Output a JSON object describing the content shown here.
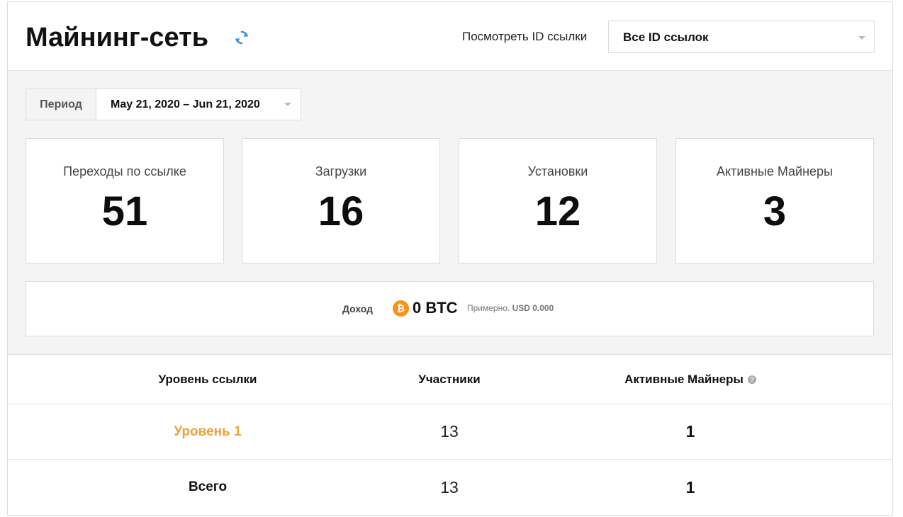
{
  "header": {
    "title": "Майнинг-сеть",
    "id_filter_label": "Посмотреть ID ссылки",
    "id_filter_value": "Все ID ссылок"
  },
  "period": {
    "label": "Период",
    "value": "May 21, 2020 – Jun 21, 2020"
  },
  "stats": [
    {
      "label": "Переходы по ссылке",
      "value": "51"
    },
    {
      "label": "Загрузки",
      "value": "16"
    },
    {
      "label": "Установки",
      "value": "12"
    },
    {
      "label": "Активные Майнеры",
      "value": "3"
    }
  ],
  "income": {
    "label": "Доход",
    "icon": "bitcoin-icon",
    "icon_glyph": "₿",
    "value": "0 BTC",
    "approx_label": "Примерно.",
    "approx_usd": "USD 0.000"
  },
  "table": {
    "columns": [
      "Уровень ссылки",
      "Участники",
      "Активные Майнеры"
    ],
    "help_glyph": "?",
    "rows": [
      {
        "level": "Уровень 1",
        "participants": "13",
        "active_miners": "1"
      },
      {
        "level": "Всего",
        "participants": "13",
        "active_miners": "1"
      }
    ]
  },
  "colors": {
    "accent": "#f0a23a",
    "refresh_icon": "#4a90d9",
    "bitcoin": "#f7931a",
    "background_section": "#f4f4f4"
  }
}
